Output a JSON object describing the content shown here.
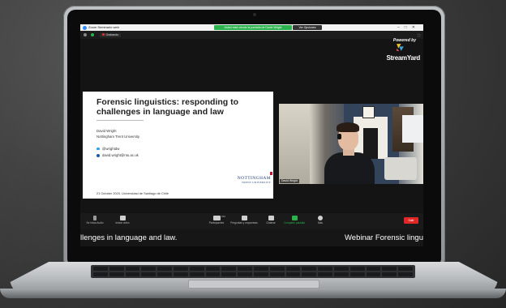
{
  "window": {
    "title": "Zoom Seminario web",
    "share_banner": "Usted está viendo la pantalla de David Wright",
    "view_options": "Ver Opciones",
    "recording": "Grabando"
  },
  "branding": {
    "powered_by": "Powered by",
    "name": "StreamYard"
  },
  "slide": {
    "title": "Forensic linguistics: responding to challenges in language and law",
    "author": "David Wright",
    "university": "Nottingham Trent University",
    "twitter": "@wrightdw",
    "email": "david.wright@ntu.ac.uk",
    "date_line": "21 October 2020, Universidad de Santiago de Chile",
    "logo_line1": "NOTTINGHAM",
    "logo_line2": "TRENT UNIVERSITY"
  },
  "webcam": {
    "participant_name": "David Wright"
  },
  "toolbar": {
    "audio": "Se Inicia Audio",
    "video": "Iniciar video",
    "participants_count": "232",
    "participants": "Participantes",
    "qa": "Preguntas y respuestas",
    "chat": "Chatear",
    "share": "Compartir pantalla",
    "more": "Más",
    "leave": "Salir"
  },
  "ticker": {
    "left": "llenges in language and law.",
    "right": "Webinar Forensic lingu"
  },
  "colors": {
    "share_green": "#2bb24c",
    "leave_red": "#e02828",
    "zoom_blue": "#2d8cff",
    "ntu_blue": "#1f3b73"
  }
}
